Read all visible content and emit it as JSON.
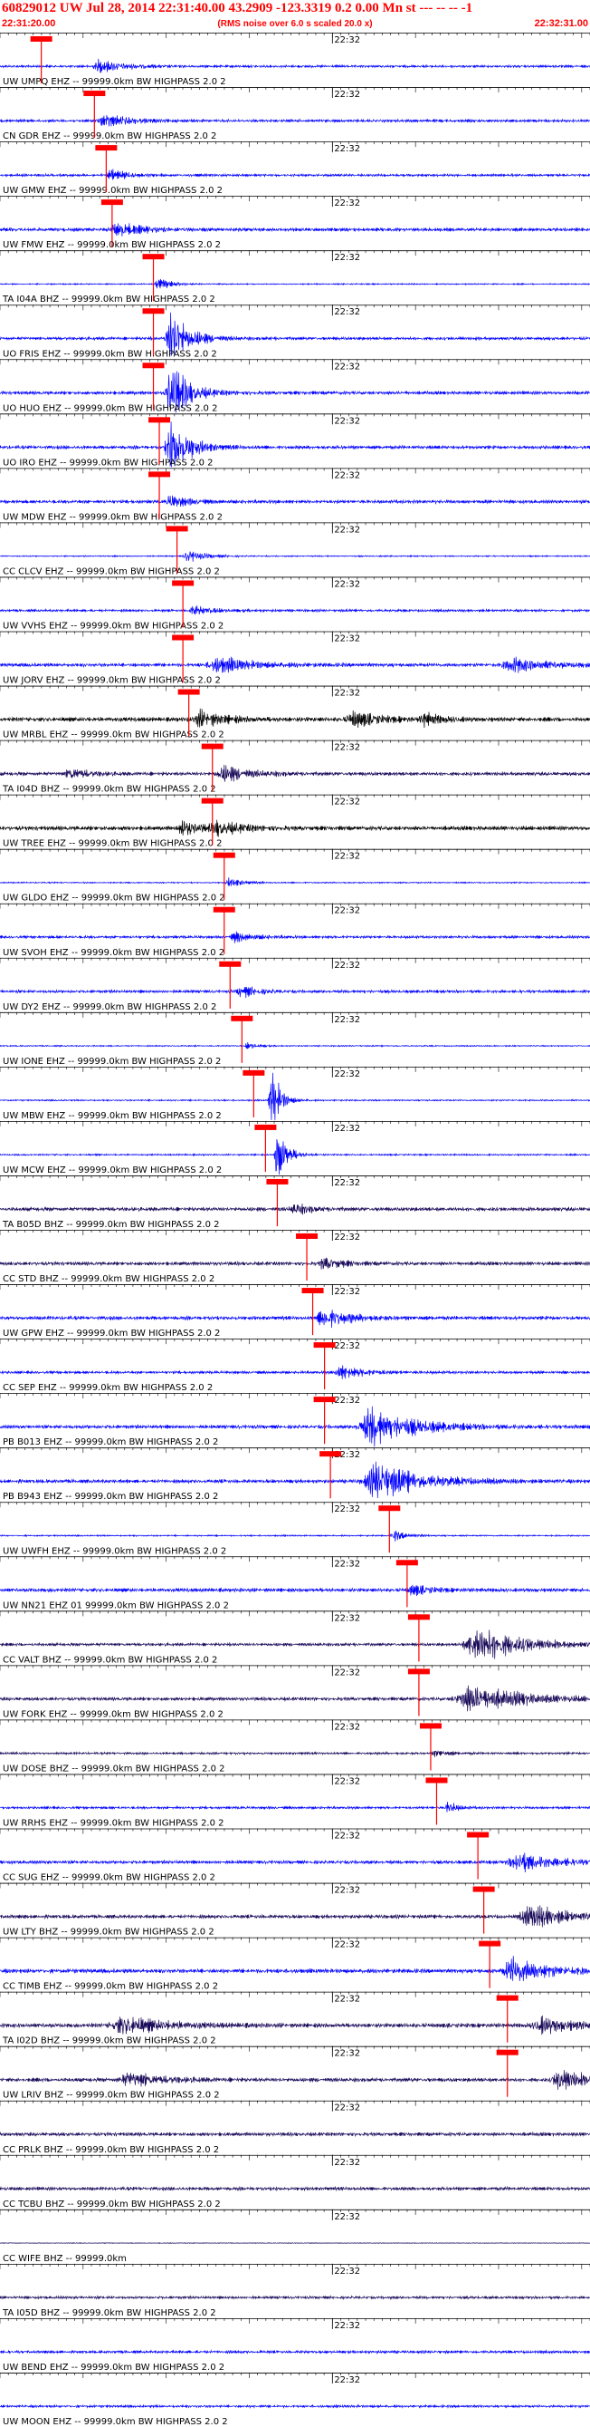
{
  "header": {
    "title": "60829012 UW Jul 28, 2014 22:31:40.00   43.2909 -123.3319  0.2 0.00 Mn st --- -- -- -1",
    "start_time": "22:31:20.00",
    "end_time": "22:32:31.00",
    "note": "(RMS noise over 6.0 s scaled 20.0 x)"
  },
  "chart_data": {
    "type": "line",
    "title": "60829012 UW Jul 28, 2014 22:31:40.00   43.2909 -123.3319  0.2 0.00 Mn st --- -- -- -1",
    "x_start": "22:31:20.00",
    "x_end": "22:32:31.00",
    "time_marker_label": "22:32",
    "minute_mark_time": "22:32:00",
    "grid": false,
    "colors": {
      "blue_trace": "#0000ff",
      "black_trace": "#000000",
      "purple_trace": "#1a0a5a",
      "pick": "#ff0000",
      "label": "#000000"
    },
    "traces": [
      {
        "label": "UW UMPQ EHZ -- 99999.0km BW HIGHPASS  2.0  2",
        "color": "blue",
        "pick_frac": 0.07,
        "events": [
          [
            0.17,
            1.0,
            0.03
          ]
        ],
        "noise": 0.2
      },
      {
        "label": "CN GDR EHZ -- 99999.0km BW HIGHPASS  2.0  2",
        "color": "blue",
        "pick_frac": 0.16,
        "events": [
          [
            0.18,
            1.0,
            0.03
          ]
        ],
        "noise": 0.22
      },
      {
        "label": "UW GMW EHZ -- 99999.0km BW HIGHPASS  2.0  2",
        "color": "blue",
        "pick_frac": 0.18,
        "events": [
          [
            0.19,
            0.9,
            0.02
          ]
        ],
        "noise": 0.2
      },
      {
        "label": "UW FMW EHZ -- 99999.0km BW HIGHPASS  2.0  2",
        "color": "blue",
        "pick_frac": 0.19,
        "events": [
          [
            0.2,
            1.1,
            0.03
          ]
        ],
        "noise": 0.28
      },
      {
        "label": "TA I04A BHZ -- 99999.0km BW HIGHPASS  2.0  2",
        "color": "blue",
        "pick_frac": 0.26,
        "events": [
          [
            0.27,
            1.0,
            0.015
          ]
        ],
        "noise": 0.1
      },
      {
        "label": "UO FRIS EHZ -- 99999.0km BW HIGHPASS  2.0  2",
        "color": "blue",
        "pick_frac": 0.26,
        "events": [
          [
            0.29,
            5.0,
            0.02
          ]
        ],
        "noise": 0.25
      },
      {
        "label": "UO HUO EHZ -- 99999.0km BW HIGHPASS  2.0  2",
        "color": "blue",
        "pick_frac": 0.26,
        "events": [
          [
            0.29,
            5.0,
            0.02
          ]
        ],
        "noise": 0.28
      },
      {
        "label": "UO IRO EHZ -- 99999.0km BW HIGHPASS  2.0  2",
        "color": "blue",
        "pick_frac": 0.27,
        "events": [
          [
            0.29,
            5.0,
            0.02
          ]
        ],
        "noise": 0.28
      },
      {
        "label": "UW MDW EHZ -- 99999.0km BW HIGHPASS  2.0  2",
        "color": "blue",
        "pick_frac": 0.27,
        "events": [
          [
            0.29,
            1.0,
            0.02
          ]
        ],
        "noise": 0.28
      },
      {
        "label": "CC CLCV EHZ -- 99999.0km BW HIGHPASS  2.0  2",
        "color": "blue",
        "pick_frac": 0.3,
        "events": [
          [
            0.32,
            1.0,
            0.02
          ]
        ],
        "noise": 0.1
      },
      {
        "label": "UW VVHS EHZ -- 99999.0km BW HIGHPASS  2.0  2",
        "color": "blue",
        "pick_frac": 0.31,
        "events": [
          [
            0.33,
            0.8,
            0.02
          ]
        ],
        "noise": 0.2
      },
      {
        "label": "UW JORV EHZ -- 99999.0km BW HIGHPASS  2.0  2",
        "color": "blue",
        "pick_frac": 0.31,
        "events": [
          [
            0.37,
            1.3,
            0.04
          ],
          [
            0.87,
            1.2,
            0.04
          ]
        ],
        "noise": 0.3
      },
      {
        "label": "UW MRBL EHZ -- 99999.0km BW HIGHPASS  2.0  2",
        "color": "black",
        "pick_frac": 0.32,
        "events": [
          [
            0.34,
            1.3,
            0.03
          ],
          [
            0.6,
            1.2,
            0.03
          ],
          [
            0.72,
            0.9,
            0.02
          ]
        ],
        "noise": 0.35
      },
      {
        "label": "TA I04D BHZ -- 99999.0km BW HIGHPASS  2.0  2",
        "color": "purple",
        "pick_frac": 0.36,
        "events": [
          [
            0.12,
            1.0,
            0.02
          ],
          [
            0.38,
            1.3,
            0.03
          ]
        ],
        "noise": 0.3
      },
      {
        "label": "UW TREE EHZ -- 99999.0km BW HIGHPASS  2.0  2",
        "color": "black",
        "pick_frac": 0.36,
        "events": [
          [
            0.31,
            1.3,
            0.02
          ],
          [
            0.37,
            1.0,
            0.03
          ]
        ],
        "noise": 0.35
      },
      {
        "label": "UW GLDO EHZ -- 99999.0km BW HIGHPASS  2.0  2",
        "color": "blue",
        "pick_frac": 0.38,
        "events": [
          [
            0.39,
            0.8,
            0.015
          ]
        ],
        "noise": 0.1
      },
      {
        "label": "UW SVOH EHZ -- 99999.0km BW HIGHPASS  2.0  2",
        "color": "blue",
        "pick_frac": 0.38,
        "events": [
          [
            0.4,
            0.8,
            0.02
          ]
        ],
        "noise": 0.22
      },
      {
        "label": "UW DY2 EHZ -- 99999.0km BW HIGHPASS  2.0  2",
        "color": "blue",
        "pick_frac": 0.39,
        "events": [
          [
            0.41,
            0.9,
            0.02
          ]
        ],
        "noise": 0.24
      },
      {
        "label": "UW IONE EHZ -- 99999.0km BW HIGHPASS  2.0  2",
        "color": "blue",
        "pick_frac": 0.41,
        "events": [
          [
            0.42,
            0.6,
            0.01
          ]
        ],
        "noise": 0.1
      },
      {
        "label": "UW MBW EHZ -- 99999.0km BW HIGHPASS  2.0  2",
        "color": "blue",
        "pick_frac": 0.43,
        "events": [
          [
            0.46,
            6.0,
            0.01
          ]
        ],
        "noise": 0.12
      },
      {
        "label": "UW MCW EHZ -- 99999.0km BW HIGHPASS  2.0  2",
        "color": "blue",
        "pick_frac": 0.45,
        "events": [
          [
            0.47,
            6.0,
            0.01
          ]
        ],
        "noise": 0.12
      },
      {
        "label": "TA B05D BHZ -- 99999.0km BW HIGHPASS  2.0  2",
        "color": "purple",
        "pick_frac": 0.47,
        "events": [
          [
            0.5,
            0.8,
            0.02
          ]
        ],
        "noise": 0.32
      },
      {
        "label": "CC STD BHZ -- 99999.0km BW HIGHPASS  2.0  2",
        "color": "purple",
        "pick_frac": 0.52,
        "events": [
          [
            0.55,
            1.0,
            0.02
          ]
        ],
        "noise": 0.3
      },
      {
        "label": "UW GPW EHZ -- 99999.0km BW HIGHPASS  2.0  2",
        "color": "blue",
        "pick_frac": 0.53,
        "events": [
          [
            0.55,
            1.6,
            0.03
          ]
        ],
        "noise": 0.3
      },
      {
        "label": "CC SEP EHZ -- 99999.0km BW HIGHPASS  2.0  2",
        "color": "blue",
        "pick_frac": 0.55,
        "events": [
          [
            0.58,
            1.0,
            0.03
          ]
        ],
        "noise": 0.22
      },
      {
        "label": "PB B013 EHZ -- 99999.0km BW HIGHPASS  2.0  2",
        "color": "blue",
        "pick_frac": 0.55,
        "events": [
          [
            0.63,
            3.0,
            0.05
          ]
        ],
        "noise": 0.3
      },
      {
        "label": "PB B943 EHZ -- 99999.0km BW HIGHPASS  2.0  2",
        "color": "blue",
        "pick_frac": 0.56,
        "events": [
          [
            0.64,
            3.0,
            0.05
          ]
        ],
        "noise": 0.3
      },
      {
        "label": "UW UWFH EHZ -- 99999.0km BW HIGHPASS  2.0  2",
        "color": "blue",
        "pick_frac": 0.66,
        "events": [
          [
            0.67,
            0.8,
            0.015
          ]
        ],
        "noise": 0.12
      },
      {
        "label": "UW NN21 EHZ 01 99999.0km BW HIGHPASS  2.0  2",
        "color": "blue",
        "pick_frac": 0.69,
        "events": [
          [
            0.7,
            0.8,
            0.02
          ]
        ],
        "noise": 0.3
      },
      {
        "label": "CC VALT BHZ -- 99999.0km BW HIGHPASS  2.0  2",
        "color": "purple",
        "pick_frac": 0.71,
        "events": [
          [
            0.81,
            3.0,
            0.05
          ]
        ],
        "noise": 0.25
      },
      {
        "label": "UW FORK EHZ -- 99999.0km BW HIGHPASS  2.0  2",
        "color": "purple",
        "pick_frac": 0.71,
        "events": [
          [
            0.8,
            2.2,
            0.06
          ]
        ],
        "noise": 0.28
      },
      {
        "label": "UW DOSE BHZ -- 99999.0km BW HIGHPASS  2.0  2",
        "color": "purple",
        "pick_frac": 0.73,
        "events": [
          [
            0.74,
            0.6,
            0.015
          ]
        ],
        "noise": 0.18
      },
      {
        "label": "UW RRHS EHZ -- 99999.0km BW HIGHPASS  2.0  2",
        "color": "blue",
        "pick_frac": 0.74,
        "events": [
          [
            0.76,
            1.0,
            0.01
          ]
        ],
        "noise": 0.2
      },
      {
        "label": "CC SUG EHZ -- 99999.0km BW HIGHPASS  2.0  2",
        "color": "blue",
        "pick_frac": 0.81,
        "events": [
          [
            0.88,
            1.6,
            0.04
          ]
        ],
        "noise": 0.28
      },
      {
        "label": "UW LTY BHZ -- 99999.0km BW HIGHPASS  2.0  2",
        "color": "purple",
        "pick_frac": 0.82,
        "events": [
          [
            0.9,
            2.0,
            0.04
          ]
        ],
        "noise": 0.3
      },
      {
        "label": "CC TIMB EHZ -- 99999.0km BW HIGHPASS  2.0  2",
        "color": "blue",
        "pick_frac": 0.83,
        "events": [
          [
            0.87,
            2.2,
            0.04
          ]
        ],
        "noise": 0.35
      },
      {
        "label": "TA I02D BHZ -- 99999.0km BW HIGHPASS  2.0  2",
        "color": "purple",
        "pick_frac": 0.86,
        "events": [
          [
            0.21,
            1.4,
            0.05
          ],
          [
            0.92,
            1.2,
            0.04
          ]
        ],
        "noise": 0.35
      },
      {
        "label": "UW LRIV BHZ -- 99999.0km BW HIGHPASS  2.0  2",
        "color": "purple",
        "pick_frac": 0.86,
        "events": [
          [
            0.95,
            1.8,
            0.03
          ],
          [
            0.22,
            1.2,
            0.04
          ]
        ],
        "noise": 0.32
      },
      {
        "label": "CC PRLK BHZ -- 99999.0km BW HIGHPASS  2.0  2",
        "color": "purple",
        "pick_frac": null,
        "events": [],
        "noise": 0.3
      },
      {
        "label": "CC TCBU BHZ -- 99999.0km BW HIGHPASS  2.0  2",
        "color": "purple",
        "pick_frac": null,
        "events": [],
        "noise": 0.28
      },
      {
        "label": "CC WIFE BHZ -- 99999.0km",
        "color": "purple",
        "pick_frac": null,
        "events": [],
        "noise": 0.05
      },
      {
        "label": "TA I05D BHZ -- 99999.0km BW HIGHPASS  2.0  2",
        "color": "purple",
        "pick_frac": null,
        "events": [],
        "noise": 0.22
      },
      {
        "label": "UW BEND EHZ -- 99999.0km BW HIGHPASS  2.0  2",
        "color": "blue",
        "pick_frac": null,
        "events": [],
        "noise": 0.22
      },
      {
        "label": "UW MOON EHZ -- 99999.0km BW HIGHPASS  2.0  2",
        "color": "blue",
        "pick_frac": null,
        "events": [],
        "noise": 0.2
      }
    ]
  }
}
